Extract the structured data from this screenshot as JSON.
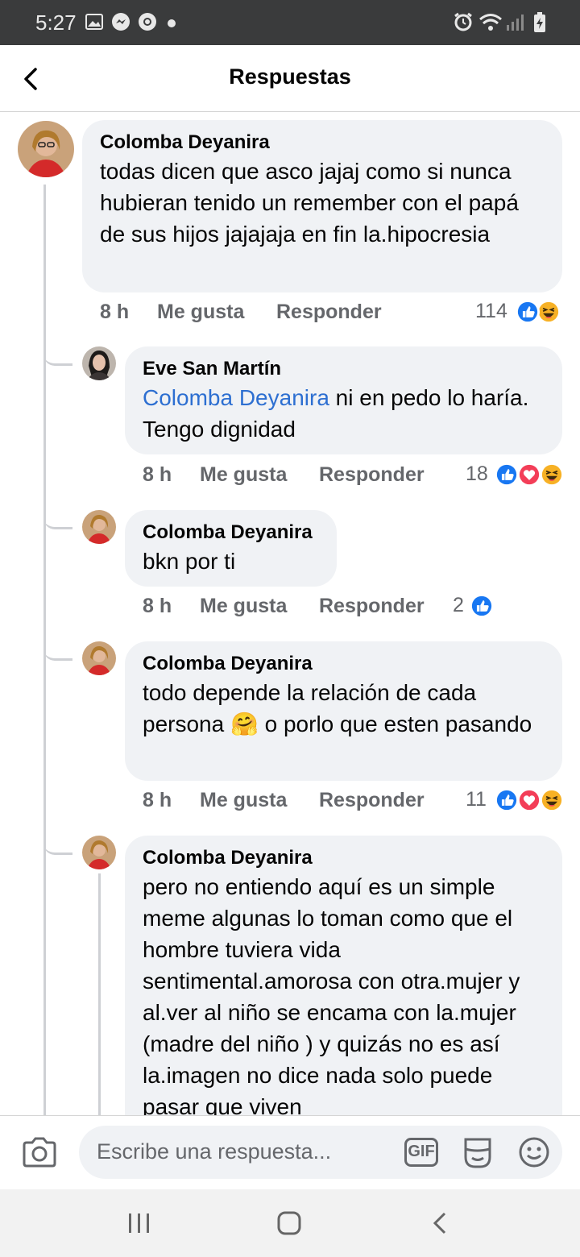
{
  "status_bar": {
    "time": "5:27"
  },
  "header": {
    "title": "Respuestas"
  },
  "comments": [
    {
      "author": "Colomba Deyanira",
      "text": "todas dicen que asco jajaj como si nunca hubieran tenido un remember con el papá de sus hijos jajajaja en fin la.hipocresia",
      "time": "8 h",
      "like_label": "Me gusta",
      "reply_label": "Responder",
      "reaction_count": "114",
      "reactions": [
        "like-reaction-icon",
        "haha-reaction-icon"
      ]
    },
    {
      "author": "Eve San Martín",
      "mention": "Colomba Deyanira",
      "text": " ni en pedo lo haría. Tengo dignidad",
      "time": "8 h",
      "like_label": "Me gusta",
      "reply_label": "Responder",
      "reaction_count": "18",
      "reactions": [
        "like-reaction-icon",
        "love-reaction-icon",
        "haha-reaction-icon"
      ]
    },
    {
      "author": "Colomba Deyanira",
      "text": "bkn por ti",
      "time": "8 h",
      "like_label": "Me gusta",
      "reply_label": "Responder",
      "reaction_count": "2",
      "reactions": [
        "like-reaction-icon"
      ]
    },
    {
      "author": "Colomba Deyanira",
      "text_before": "todo depende la relación de cada persona",
      "emoji": "🤗",
      "text_after": "o porlo que esten pasando",
      "time": "8 h",
      "like_label": "Me gusta",
      "reply_label": "Responder",
      "reaction_count": "11",
      "reactions": [
        "like-reaction-icon",
        "love-reaction-icon",
        "haha-reaction-icon"
      ]
    },
    {
      "author": "Colomba Deyanira",
      "text": "pero no entiendo aquí es un simple meme algunas lo toman como que el hombre tuviera vida sentimental.amorosa con otra.mujer y al.ver al niño se encama con la.mujer (madre del niño ) y quizás no es así la.imagen no dice nada solo puede pasar que viven"
    }
  ],
  "composer": {
    "placeholder": "Escribe una respuesta...",
    "gif_label": "GIF"
  },
  "colors": {
    "like": "#1877f2",
    "love": "#f33e58",
    "haha": "#f7b125",
    "mention": "#2d6fd1",
    "bubble": "#f0f2f5"
  }
}
